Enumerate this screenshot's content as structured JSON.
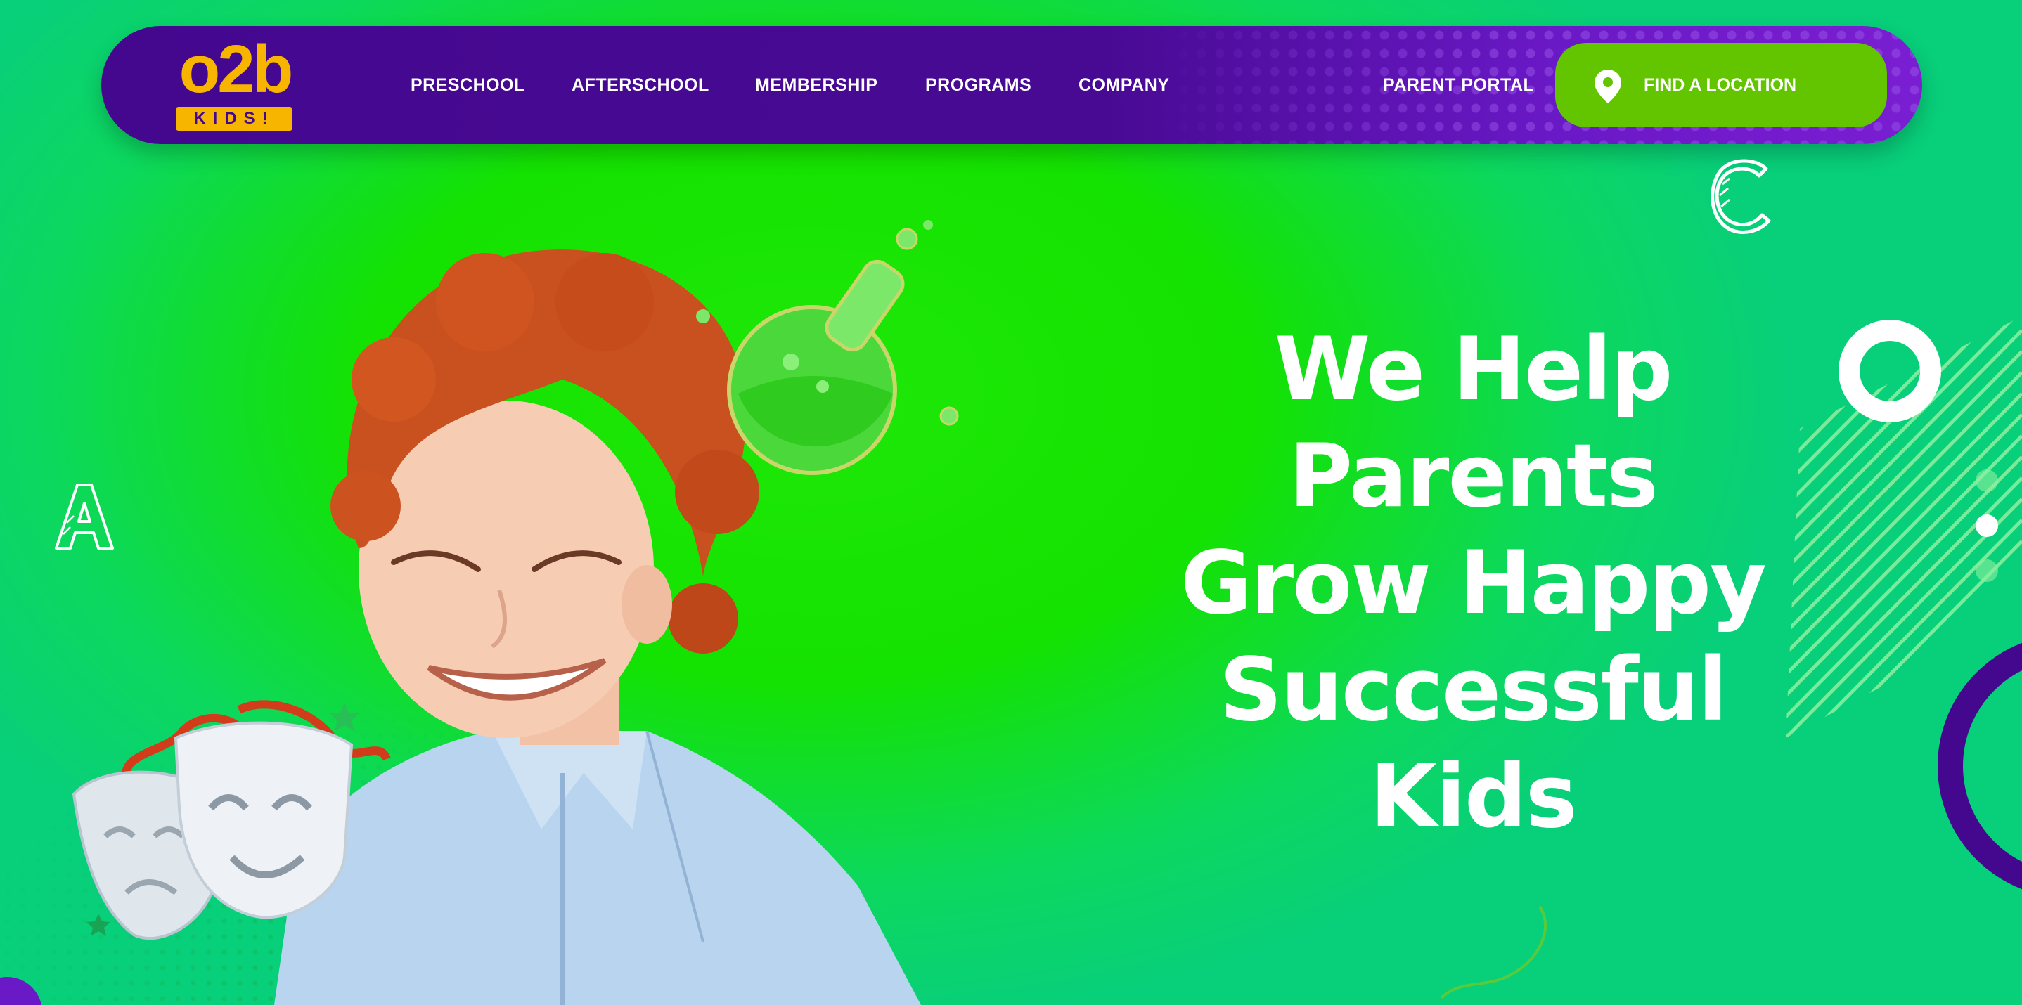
{
  "brand": {
    "logo_text": "o2b",
    "logo_sub": "KIDS!",
    "primary_color": "#44088f",
    "accent_yellow": "#f7b500",
    "accent_green": "#63c500",
    "hero_green": "#14e200"
  },
  "nav": {
    "items": [
      {
        "label": "PRESCHOOL"
      },
      {
        "label": "AFTERSCHOOL"
      },
      {
        "label": "MEMBERSHIP"
      },
      {
        "label": "PROGRAMS"
      },
      {
        "label": "COMPANY"
      }
    ],
    "parent_portal": "PARENT PORTAL",
    "cta": {
      "label": "FIND A LOCATION",
      "icon": "map-pin-icon"
    }
  },
  "hero": {
    "headline_lines": [
      "We Help",
      "Parents",
      "Grow Happy",
      "Successful",
      "Kids"
    ],
    "decorations": [
      "letter-a-icon",
      "letter-c-icon",
      "ring-icon",
      "flask-icon",
      "theater-masks-icon",
      "stripes-decoration",
      "purple-arc-decoration"
    ]
  }
}
